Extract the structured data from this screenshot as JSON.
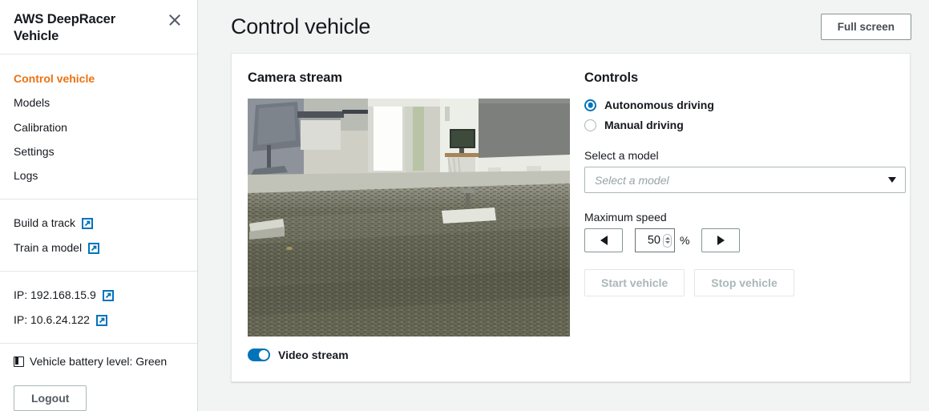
{
  "sidebar": {
    "title": "AWS DeepRacer Vehicle",
    "close_icon": "close-icon",
    "nav": [
      {
        "label": "Control vehicle",
        "active": true
      },
      {
        "label": "Models",
        "active": false
      },
      {
        "label": "Calibration",
        "active": false
      },
      {
        "label": "Settings",
        "active": false
      },
      {
        "label": "Logs",
        "active": false
      }
    ],
    "links": [
      {
        "label": "Build a track",
        "icon": "external-link-icon"
      },
      {
        "label": "Train a model",
        "icon": "external-link-icon"
      }
    ],
    "ips": [
      {
        "label": "IP: 192.168.15.9",
        "icon": "external-link-icon"
      },
      {
        "label": "IP: 10.6.24.122",
        "icon": "external-link-icon"
      }
    ],
    "battery": {
      "icon": "battery-icon",
      "label": "Vehicle battery level: Green"
    },
    "logout_label": "Logout"
  },
  "main": {
    "page_title": "Control vehicle",
    "fullscreen_label": "Full screen",
    "camera": {
      "section_title": "Camera stream",
      "toggle_label": "Video stream",
      "toggle_on": true
    },
    "controls": {
      "section_title": "Controls",
      "driving_modes": [
        {
          "label": "Autonomous driving",
          "selected": true
        },
        {
          "label": "Manual driving",
          "selected": false
        }
      ],
      "model_label": "Select a model",
      "model_placeholder": "Select a model",
      "model_value": "",
      "speed_label": "Maximum speed",
      "speed_value": "50",
      "speed_unit": "%",
      "decrement_icon": "triangle-left-icon",
      "increment_icon": "triangle-right-icon",
      "start_label": "Start vehicle",
      "stop_label": "Stop vehicle",
      "start_disabled": true,
      "stop_disabled": true
    }
  },
  "colors": {
    "accent_orange": "#ec7211",
    "link_blue": "#0073bb",
    "page_bg": "#f2f3f3",
    "text": "#16191f"
  }
}
